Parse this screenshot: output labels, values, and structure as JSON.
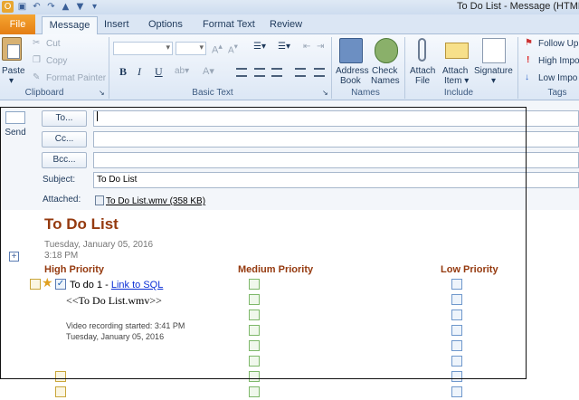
{
  "window": {
    "title": "To Do List - Message (HTML)"
  },
  "tabs": [
    {
      "label": "File"
    },
    {
      "label": "Message"
    },
    {
      "label": "Insert"
    },
    {
      "label": "Options"
    },
    {
      "label": "Format Text"
    },
    {
      "label": "Review"
    }
  ],
  "ribbon": {
    "clipboard": {
      "paste": "Paste",
      "cut": "Cut",
      "copy": "Copy",
      "format_painter": "Format Painter",
      "label": "Clipboard"
    },
    "basic_text": {
      "label": "Basic Text",
      "bold": "B",
      "italic": "I",
      "underline": "U"
    },
    "names": {
      "address_book_1": "Address",
      "address_book_2": "Book",
      "check_names_1": "Check",
      "check_names_2": "Names",
      "label": "Names"
    },
    "include": {
      "attach_file_1": "Attach",
      "attach_file_2": "File",
      "attach_item_1": "Attach",
      "attach_item_2": "Item",
      "signature": "Signature",
      "label": "Include"
    },
    "tags": {
      "follow_up": "Follow Up",
      "high": "High Impo",
      "low": "Low Impo",
      "label": "Tags"
    }
  },
  "header": {
    "send": "Send",
    "to": "To...",
    "cc": "Cc...",
    "bcc": "Bcc...",
    "subject_label": "Subject:",
    "subject_value": "To Do List",
    "attached_label": "Attached:",
    "attachment": "To Do List.wmv (358 KB)"
  },
  "note": {
    "title": "To Do List",
    "date": "Tuesday, January 05, 2016",
    "time": "3:18 PM",
    "col_high": "High Priority",
    "col_medium": "Medium Priority",
    "col_low": "Low Priority",
    "item_text": "To do 1 - ",
    "item_link": "Link to SQL",
    "attachment_ref": "<<To Do List.wmv>>",
    "rec_line1": "Video recording started: 3:41 PM",
    "rec_line2": "Tuesday, January 05, 2016"
  },
  "colors": {
    "note_accent": "#953a0f",
    "file_tab": "#e47e14",
    "link": "#0b2fd6"
  }
}
